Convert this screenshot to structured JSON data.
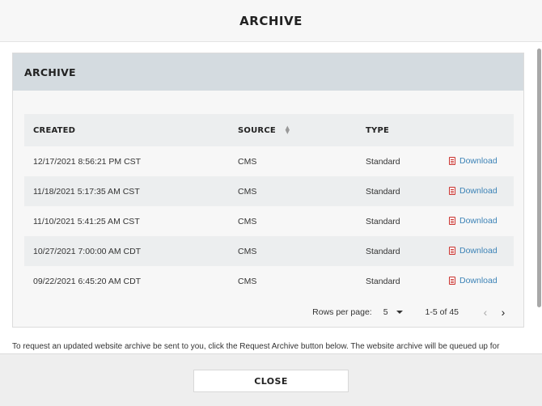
{
  "modal": {
    "title": "ARCHIVE",
    "close_label": "CLOSE"
  },
  "panel": {
    "title": "ARCHIVE"
  },
  "table": {
    "headers": {
      "created": "CREATED",
      "source": "SOURCE",
      "type": "TYPE"
    },
    "rows": [
      {
        "created": "12/17/2021 8:56:21 PM CST",
        "source": "CMS",
        "type": "Standard",
        "action": "Download"
      },
      {
        "created": "11/18/2021 5:17:35 AM CST",
        "source": "CMS",
        "type": "Standard",
        "action": "Download"
      },
      {
        "created": "11/10/2021 5:41:25 AM CST",
        "source": "CMS",
        "type": "Standard",
        "action": "Download"
      },
      {
        "created": "10/27/2021 7:00:00 AM CDT",
        "source": "CMS",
        "type": "Standard",
        "action": "Download"
      },
      {
        "created": "09/22/2021 6:45:20 AM CDT",
        "source": "CMS",
        "type": "Standard",
        "action": "Download"
      }
    ]
  },
  "pagination": {
    "rows_per_page_label": "Rows per page:",
    "rows_per_page_value": "5",
    "range": "1-5 of 45",
    "prev_icon": "‹",
    "next_icon": "›"
  },
  "note": "To request an updated website archive be sent to you, click the Request Archive button below. The website archive will be queued up for immediate processing and you will be notified via email at the following address when the archive is ready: web@cmsarchive.local"
}
